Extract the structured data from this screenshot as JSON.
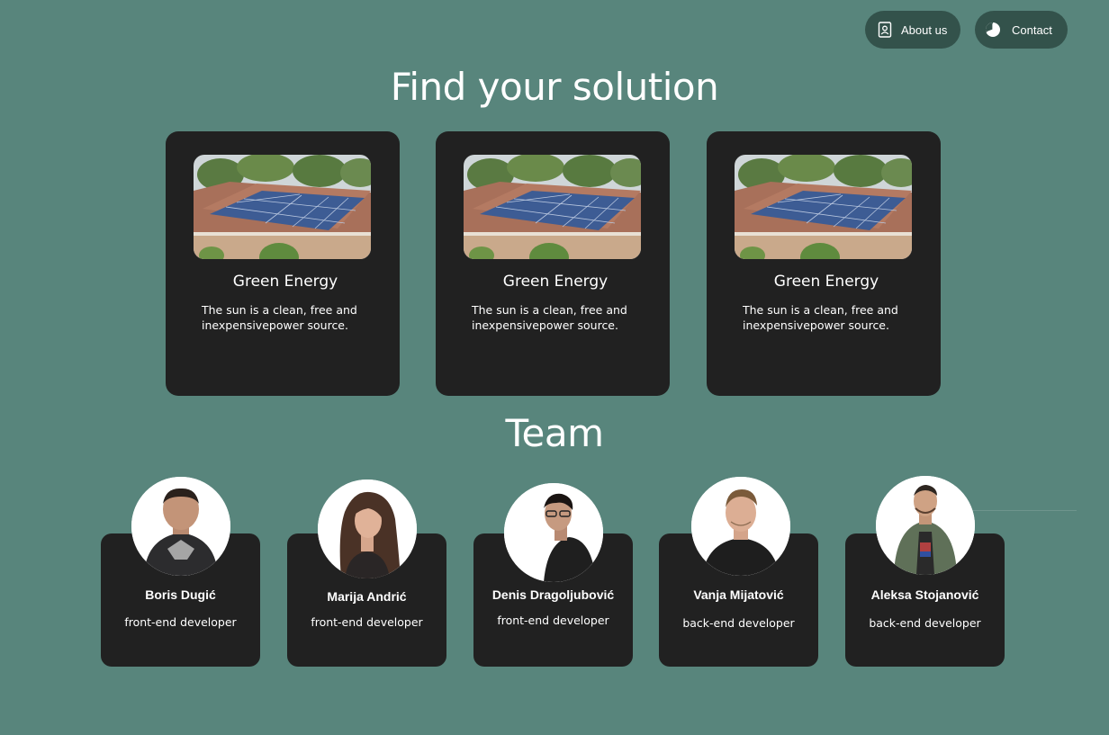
{
  "nav": {
    "about_label": "About us",
    "about_icon": "contact-card-icon",
    "contact_label": "Contact",
    "contact_icon": "pie-chart-icon"
  },
  "solutions": {
    "title": "Find your solution",
    "cards": [
      {
        "title": "Green Energy",
        "description": "The sun is a clean, free and inexpensivepower source.",
        "image": "solar-panels-roof-image"
      },
      {
        "title": "Green Energy",
        "description": "The sun is a clean, free and inexpensivepower source.",
        "image": "solar-panels-roof-image"
      },
      {
        "title": "Green Energy",
        "description": "The sun is a clean, free and inexpensivepower source.",
        "image": "solar-panels-roof-image"
      }
    ]
  },
  "team": {
    "title": "Team",
    "members": [
      {
        "name": "Boris Dugić",
        "role": "front-end developer"
      },
      {
        "name": "Marija Andrić",
        "role": "front-end developer"
      },
      {
        "name": "Denis Dragoljubović",
        "role": "front-end developer"
      },
      {
        "name": "Vanja Mijatović",
        "role": "back-end developer"
      },
      {
        "name": "Aleksa  Stojanović",
        "role": "back-end developer"
      }
    ]
  },
  "colors": {
    "background": "#58857c",
    "card": "#212121",
    "nav_button": "#33524b",
    "text": "#ffffff"
  }
}
